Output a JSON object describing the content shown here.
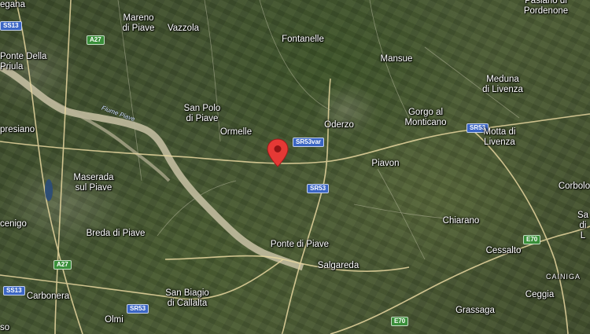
{
  "map": {
    "view": "satellite",
    "marker": {
      "type": "red-location-pin"
    },
    "places": [
      {
        "id": "egana",
        "name": "egana"
      },
      {
        "id": "mareno",
        "name": "Mareno\ndi Piave"
      },
      {
        "id": "vazzola",
        "name": "Vazzola"
      },
      {
        "id": "fontanelle",
        "name": "Fontanelle"
      },
      {
        "id": "pasiano",
        "name": "Pasiano di\nPordenone"
      },
      {
        "id": "ponte-priula",
        "name": "Ponte Della\nPriula"
      },
      {
        "id": "mansue",
        "name": "Mansue"
      },
      {
        "id": "meduna",
        "name": "Meduna\ndi Livenza"
      },
      {
        "id": "san-polo",
        "name": "San Polo\ndi Piave"
      },
      {
        "id": "spresiano",
        "name": "presiano"
      },
      {
        "id": "ormelle",
        "name": "Ormelle"
      },
      {
        "id": "oderzo",
        "name": "Oderzo"
      },
      {
        "id": "gorgo",
        "name": "Gorgo al\nMonticano"
      },
      {
        "id": "motta",
        "name": "Motta di\nLivenza"
      },
      {
        "id": "piavon",
        "name": "Piavon"
      },
      {
        "id": "maserada",
        "name": "Maserada\nsul Piave"
      },
      {
        "id": "corbolo",
        "name": "Corbolo"
      },
      {
        "id": "chiarano",
        "name": "Chiarano"
      },
      {
        "id": "cenigo",
        "name": "cenigo"
      },
      {
        "id": "breda",
        "name": "Breda di Piave"
      },
      {
        "id": "ponte-piave",
        "name": "Ponte di Piave"
      },
      {
        "id": "san-stino",
        "name": "Sa\ndi L"
      },
      {
        "id": "salgareda",
        "name": "Salgareda"
      },
      {
        "id": "cessalto",
        "name": "Cessalto"
      },
      {
        "id": "carbonera",
        "name": "Carbonera"
      },
      {
        "id": "san-biagio",
        "name": "San Biagio\ndi Callalta"
      },
      {
        "id": "ceggia",
        "name": "Ceggia"
      },
      {
        "id": "grassaga",
        "name": "Grassaga"
      },
      {
        "id": "olmi",
        "name": "Olmi"
      },
      {
        "id": "so",
        "name": "so"
      }
    ],
    "road_shields": [
      {
        "id": "sr13-top",
        "label": "SS13",
        "color": "#3b66c4"
      },
      {
        "id": "a27-top",
        "label": "A27",
        "color": "#3a8f3a"
      },
      {
        "id": "sr53var",
        "label": "SR53var",
        "color": "#3b66c4"
      },
      {
        "id": "sr53-mid",
        "label": "SR53",
        "color": "#3b66c4"
      },
      {
        "id": "sr53-right",
        "label": "SR53",
        "color": "#3b66c4"
      },
      {
        "id": "a27-bottom",
        "label": "A27",
        "color": "#3a8f3a"
      },
      {
        "id": "sr13-bottom",
        "label": "SS13",
        "color": "#3b66c4"
      },
      {
        "id": "sr53-bottom",
        "label": "SR53",
        "color": "#3b66c4"
      },
      {
        "id": "e70-right",
        "label": "E70",
        "color": "#3a8f3a"
      },
      {
        "id": "e70-bottom",
        "label": "E70",
        "color": "#3a8f3a"
      }
    ],
    "river_label": "Fiume Piave",
    "corner_label": "CAINIGA"
  }
}
